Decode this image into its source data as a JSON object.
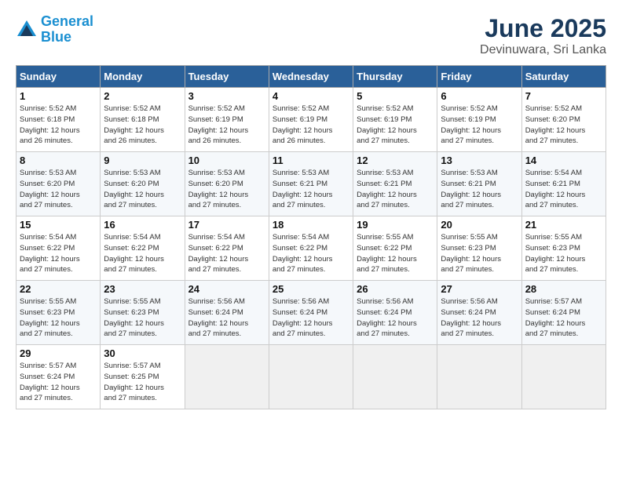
{
  "logo": {
    "line1": "General",
    "line2": "Blue"
  },
  "title": "June 2025",
  "location": "Devinuwara, Sri Lanka",
  "headers": [
    "Sunday",
    "Monday",
    "Tuesday",
    "Wednesday",
    "Thursday",
    "Friday",
    "Saturday"
  ],
  "weeks": [
    [
      {
        "day": "1",
        "info": "Sunrise: 5:52 AM\nSunset: 6:18 PM\nDaylight: 12 hours\nand 26 minutes."
      },
      {
        "day": "2",
        "info": "Sunrise: 5:52 AM\nSunset: 6:18 PM\nDaylight: 12 hours\nand 26 minutes."
      },
      {
        "day": "3",
        "info": "Sunrise: 5:52 AM\nSunset: 6:19 PM\nDaylight: 12 hours\nand 26 minutes."
      },
      {
        "day": "4",
        "info": "Sunrise: 5:52 AM\nSunset: 6:19 PM\nDaylight: 12 hours\nand 26 minutes."
      },
      {
        "day": "5",
        "info": "Sunrise: 5:52 AM\nSunset: 6:19 PM\nDaylight: 12 hours\nand 27 minutes."
      },
      {
        "day": "6",
        "info": "Sunrise: 5:52 AM\nSunset: 6:19 PM\nDaylight: 12 hours\nand 27 minutes."
      },
      {
        "day": "7",
        "info": "Sunrise: 5:52 AM\nSunset: 6:20 PM\nDaylight: 12 hours\nand 27 minutes."
      }
    ],
    [
      {
        "day": "8",
        "info": "Sunrise: 5:53 AM\nSunset: 6:20 PM\nDaylight: 12 hours\nand 27 minutes."
      },
      {
        "day": "9",
        "info": "Sunrise: 5:53 AM\nSunset: 6:20 PM\nDaylight: 12 hours\nand 27 minutes."
      },
      {
        "day": "10",
        "info": "Sunrise: 5:53 AM\nSunset: 6:20 PM\nDaylight: 12 hours\nand 27 minutes."
      },
      {
        "day": "11",
        "info": "Sunrise: 5:53 AM\nSunset: 6:21 PM\nDaylight: 12 hours\nand 27 minutes."
      },
      {
        "day": "12",
        "info": "Sunrise: 5:53 AM\nSunset: 6:21 PM\nDaylight: 12 hours\nand 27 minutes."
      },
      {
        "day": "13",
        "info": "Sunrise: 5:53 AM\nSunset: 6:21 PM\nDaylight: 12 hours\nand 27 minutes."
      },
      {
        "day": "14",
        "info": "Sunrise: 5:54 AM\nSunset: 6:21 PM\nDaylight: 12 hours\nand 27 minutes."
      }
    ],
    [
      {
        "day": "15",
        "info": "Sunrise: 5:54 AM\nSunset: 6:22 PM\nDaylight: 12 hours\nand 27 minutes."
      },
      {
        "day": "16",
        "info": "Sunrise: 5:54 AM\nSunset: 6:22 PM\nDaylight: 12 hours\nand 27 minutes."
      },
      {
        "day": "17",
        "info": "Sunrise: 5:54 AM\nSunset: 6:22 PM\nDaylight: 12 hours\nand 27 minutes."
      },
      {
        "day": "18",
        "info": "Sunrise: 5:54 AM\nSunset: 6:22 PM\nDaylight: 12 hours\nand 27 minutes."
      },
      {
        "day": "19",
        "info": "Sunrise: 5:55 AM\nSunset: 6:22 PM\nDaylight: 12 hours\nand 27 minutes."
      },
      {
        "day": "20",
        "info": "Sunrise: 5:55 AM\nSunset: 6:23 PM\nDaylight: 12 hours\nand 27 minutes."
      },
      {
        "day": "21",
        "info": "Sunrise: 5:55 AM\nSunset: 6:23 PM\nDaylight: 12 hours\nand 27 minutes."
      }
    ],
    [
      {
        "day": "22",
        "info": "Sunrise: 5:55 AM\nSunset: 6:23 PM\nDaylight: 12 hours\nand 27 minutes."
      },
      {
        "day": "23",
        "info": "Sunrise: 5:55 AM\nSunset: 6:23 PM\nDaylight: 12 hours\nand 27 minutes."
      },
      {
        "day": "24",
        "info": "Sunrise: 5:56 AM\nSunset: 6:24 PM\nDaylight: 12 hours\nand 27 minutes."
      },
      {
        "day": "25",
        "info": "Sunrise: 5:56 AM\nSunset: 6:24 PM\nDaylight: 12 hours\nand 27 minutes."
      },
      {
        "day": "26",
        "info": "Sunrise: 5:56 AM\nSunset: 6:24 PM\nDaylight: 12 hours\nand 27 minutes."
      },
      {
        "day": "27",
        "info": "Sunrise: 5:56 AM\nSunset: 6:24 PM\nDaylight: 12 hours\nand 27 minutes."
      },
      {
        "day": "28",
        "info": "Sunrise: 5:57 AM\nSunset: 6:24 PM\nDaylight: 12 hours\nand 27 minutes."
      }
    ],
    [
      {
        "day": "29",
        "info": "Sunrise: 5:57 AM\nSunset: 6:24 PM\nDaylight: 12 hours\nand 27 minutes."
      },
      {
        "day": "30",
        "info": "Sunrise: 5:57 AM\nSunset: 6:25 PM\nDaylight: 12 hours\nand 27 minutes."
      },
      {
        "day": "",
        "info": ""
      },
      {
        "day": "",
        "info": ""
      },
      {
        "day": "",
        "info": ""
      },
      {
        "day": "",
        "info": ""
      },
      {
        "day": "",
        "info": ""
      }
    ]
  ]
}
